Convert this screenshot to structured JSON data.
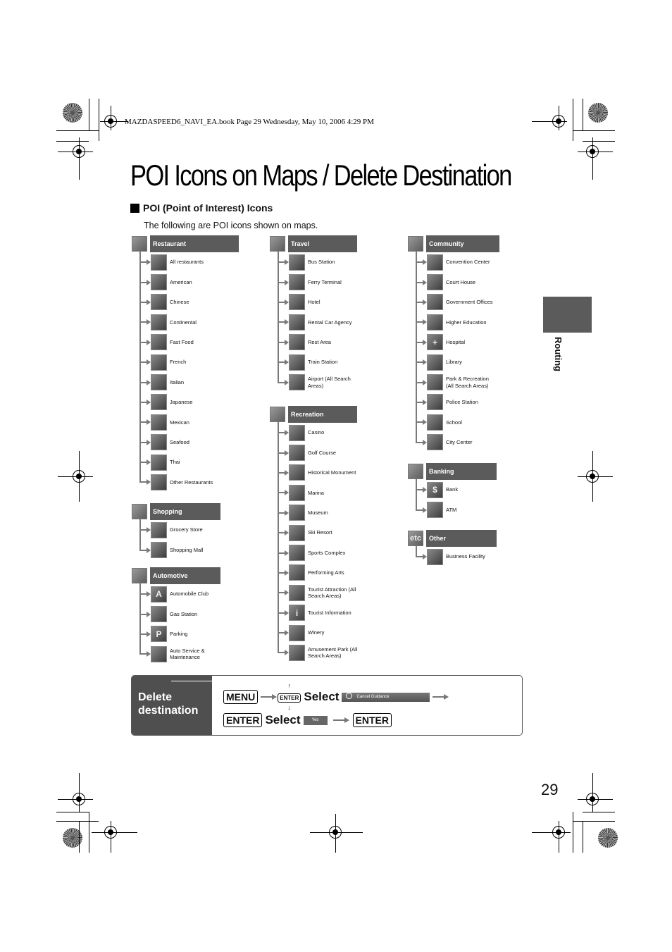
{
  "print_meta": "MAZDASPEED6_NAVI_EA.book  Page 29  Wednesday, May 10, 2006  4:29 PM",
  "title": "POI Icons on Maps / Delete Destination",
  "section": {
    "heading": "POI (Point of Interest) Icons",
    "intro": "The following are POI icons shown on maps."
  },
  "side_tab": {
    "label": "Routing"
  },
  "groups": {
    "restaurant": {
      "label": "Restaurant",
      "icon": "fork-knife-icon",
      "items": [
        {
          "label": "All restaurants",
          "icon": "fork-knife-icon"
        },
        {
          "label": "American",
          "icon": "us-flag-icon"
        },
        {
          "label": "Chinese",
          "icon": "chinese-food-icon"
        },
        {
          "label": "Continental",
          "icon": "eu-flag-icon"
        },
        {
          "label": "Fast Food",
          "icon": "burger-icon"
        },
        {
          "label": "French",
          "icon": "french-flag-icon"
        },
        {
          "label": "Italian",
          "icon": "italian-flag-icon"
        },
        {
          "label": "Japanese",
          "icon": "japan-flag-icon"
        },
        {
          "label": "Mexican",
          "icon": "mexico-flag-icon"
        },
        {
          "label": "Seafood",
          "icon": "fish-icon"
        },
        {
          "label": "Thai",
          "icon": "thai-flag-icon"
        },
        {
          "label": "Other Restaurants",
          "icon": "fork-knife-icon"
        }
      ]
    },
    "shopping": {
      "label": "Shopping",
      "icon": "shopping-bag-icon",
      "items": [
        {
          "label": "Grocery Store",
          "icon": "cart-icon"
        },
        {
          "label": "Shopping Mall",
          "icon": "shopping-bag-icon"
        }
      ]
    },
    "automotive": {
      "label": "Automotive",
      "icon": "car-icon",
      "items": [
        {
          "label": "Automobile Club",
          "icon": "auto-club-icon",
          "glyph": "A"
        },
        {
          "label": "Gas Station",
          "icon": "gas-pump-icon"
        },
        {
          "label": "Parking",
          "icon": "parking-icon",
          "glyph": "P"
        },
        {
          "label": "Auto Service & Maintenance",
          "icon": "wrench-icon"
        }
      ]
    },
    "travel": {
      "label": "Travel",
      "icon": "gate-icon",
      "items": [
        {
          "label": "Bus Station",
          "icon": "bus-icon"
        },
        {
          "label": "Ferry Terminal",
          "icon": "ferry-icon"
        },
        {
          "label": "Hotel",
          "icon": "bed-icon"
        },
        {
          "label": "Rental Car Agency",
          "icon": "key-car-icon"
        },
        {
          "label": "Rest Area",
          "icon": "bench-icon"
        },
        {
          "label": "Train Station",
          "icon": "train-icon"
        },
        {
          "label": "Airport (All Search Areas)",
          "icon": "airplane-icon"
        }
      ]
    },
    "recreation": {
      "label": "Recreation",
      "icon": "smiley-icon",
      "items": [
        {
          "label": "Casino",
          "icon": "cards-icon"
        },
        {
          "label": "Golf Course",
          "icon": "golf-flag-icon"
        },
        {
          "label": "Historical Monument",
          "icon": "monument-icon"
        },
        {
          "label": "Marina",
          "icon": "sailboat-icon"
        },
        {
          "label": "Museum",
          "icon": "portrait-icon"
        },
        {
          "label": "Ski Resort",
          "icon": "skier-icon"
        },
        {
          "label": "Sports Complex",
          "icon": "runner-icon"
        },
        {
          "label": "Performing Arts",
          "icon": "theater-icon"
        },
        {
          "label": "Tourist Attraction (All Search Areas)",
          "icon": "camera-icon"
        },
        {
          "label": "Tourist Information",
          "icon": "info-icon",
          "glyph": "i"
        },
        {
          "label": "Winery",
          "icon": "wine-bottle-icon"
        },
        {
          "label": "Amusement Park (All Search Areas)",
          "icon": "balloon-icon"
        }
      ]
    },
    "community": {
      "label": "Community",
      "icon": "community-icon",
      "items": [
        {
          "label": "Convention Center",
          "icon": "convention-icon"
        },
        {
          "label": "Court House",
          "icon": "scales-icon"
        },
        {
          "label": "Government Offices",
          "icon": "government-building-icon"
        },
        {
          "label": "Higher Education",
          "icon": "university-icon"
        },
        {
          "label": "Hospital",
          "icon": "medical-cross-icon",
          "glyph": "+"
        },
        {
          "label": "Library",
          "icon": "book-icon"
        },
        {
          "label": "Park & Recreation (All Search Areas)",
          "icon": "tree-icon"
        },
        {
          "label": "Police Station",
          "icon": "police-car-icon"
        },
        {
          "label": "School",
          "icon": "school-icon"
        },
        {
          "label": "City Center",
          "icon": "city-center-icon"
        }
      ]
    },
    "banking": {
      "label": "Banking",
      "icon": "dollar-icon",
      "items": [
        {
          "label": "Bank",
          "icon": "dollar-icon",
          "glyph": "$"
        },
        {
          "label": "ATM",
          "icon": "atm-icon"
        }
      ]
    },
    "other": {
      "label": "Other",
      "icon": "etc-icon",
      "glyph": "etc",
      "items": [
        {
          "label": "Business Facility",
          "icon": "office-building-icon"
        }
      ]
    }
  },
  "delete_destination": {
    "title_line1": "Delete",
    "title_line2": "destination",
    "key_menu": "MENU",
    "key_enter": "ENTER",
    "select_label": "Select",
    "cancel_button": "Cancel Guidance",
    "yes_button": "Yes"
  },
  "page_number": "29"
}
